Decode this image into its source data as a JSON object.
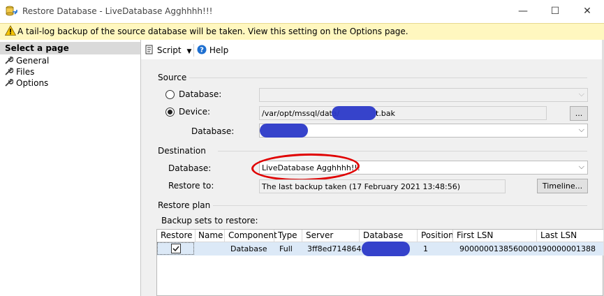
{
  "window": {
    "title": "Restore Database - LiveDatabase Agghhhh!!!",
    "minimize_glyph": "—",
    "maximize_glyph": "☐",
    "close_glyph": "✕"
  },
  "warning": {
    "icon": "warning-triangle-icon",
    "text": "A tail-log backup of the source database will be taken. View this setting on the Options page."
  },
  "left_pane": {
    "header": "Select a page",
    "items": [
      {
        "label": "General",
        "icon": "wrench-icon"
      },
      {
        "label": "Files",
        "icon": "wrench-icon"
      },
      {
        "label": "Options",
        "icon": "wrench-icon"
      }
    ]
  },
  "toolbar": {
    "script_label": "Script",
    "help_label": "Help"
  },
  "source": {
    "section_label": "Source",
    "database_radio_label": "Database:",
    "device_radio_label": "Device:",
    "device_path_prefix": "/var/opt/mssql/data/",
    "device_path_suffix": "t.bak",
    "browse_label": "...",
    "database_label": "Database:"
  },
  "destination": {
    "section_label": "Destination",
    "database_label": "Database:",
    "database_value": "LiveDatabase Agghhhh!!!",
    "restore_to_label": "Restore to:",
    "restore_to_value": "The last backup taken (17 February 2021 13:48:56)",
    "timeline_label": "Timeline..."
  },
  "restore_plan": {
    "section_label": "Restore plan",
    "backup_sets_label": "Backup sets to restore:",
    "columns": [
      "Restore",
      "Name",
      "Component",
      "Type",
      "Server",
      "Database",
      "Position",
      "First LSN",
      "Last LSN"
    ],
    "rows": [
      {
        "restore": true,
        "name": "",
        "component": "Database",
        "type": "Full",
        "server": "3ff8ed714864",
        "database": "",
        "position": "1",
        "first_lsn": "90000001385600001",
        "last_lsn": "90000001388"
      }
    ]
  },
  "colors": {
    "warning_bg": "#fff7bf",
    "annotation_red": "#e00000",
    "redaction_blue": "#2b39c8",
    "selected_row": "#dce9f7"
  }
}
